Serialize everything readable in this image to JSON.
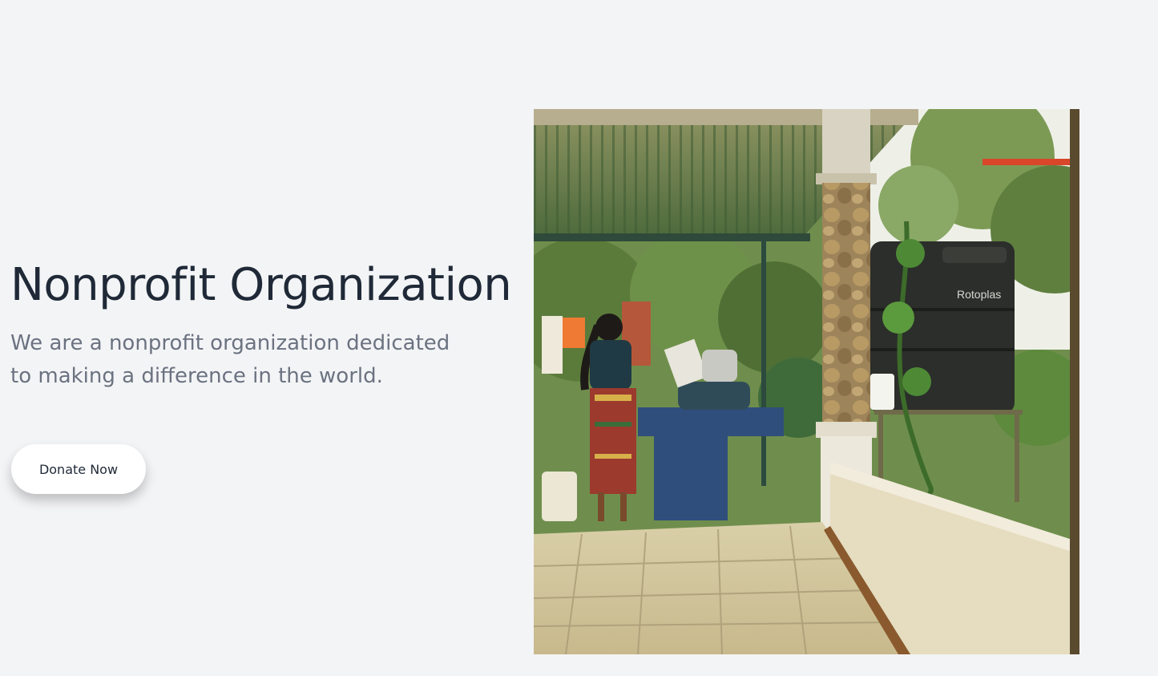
{
  "hero": {
    "title": "Nonprofit Organization",
    "subtitle": "We are a nonprofit organization dedicated to making a difference in the world.",
    "cta_label": "Donate Now"
  },
  "image": {
    "alt": "Woman washing dishes at an outdoor sink under a corrugated roof",
    "tank_brand_text": "Rotoplas"
  },
  "colors": {
    "background": "#f3f4f6",
    "title": "#1f2937",
    "subtitle": "#6b7280",
    "button_bg": "#ffffff"
  }
}
